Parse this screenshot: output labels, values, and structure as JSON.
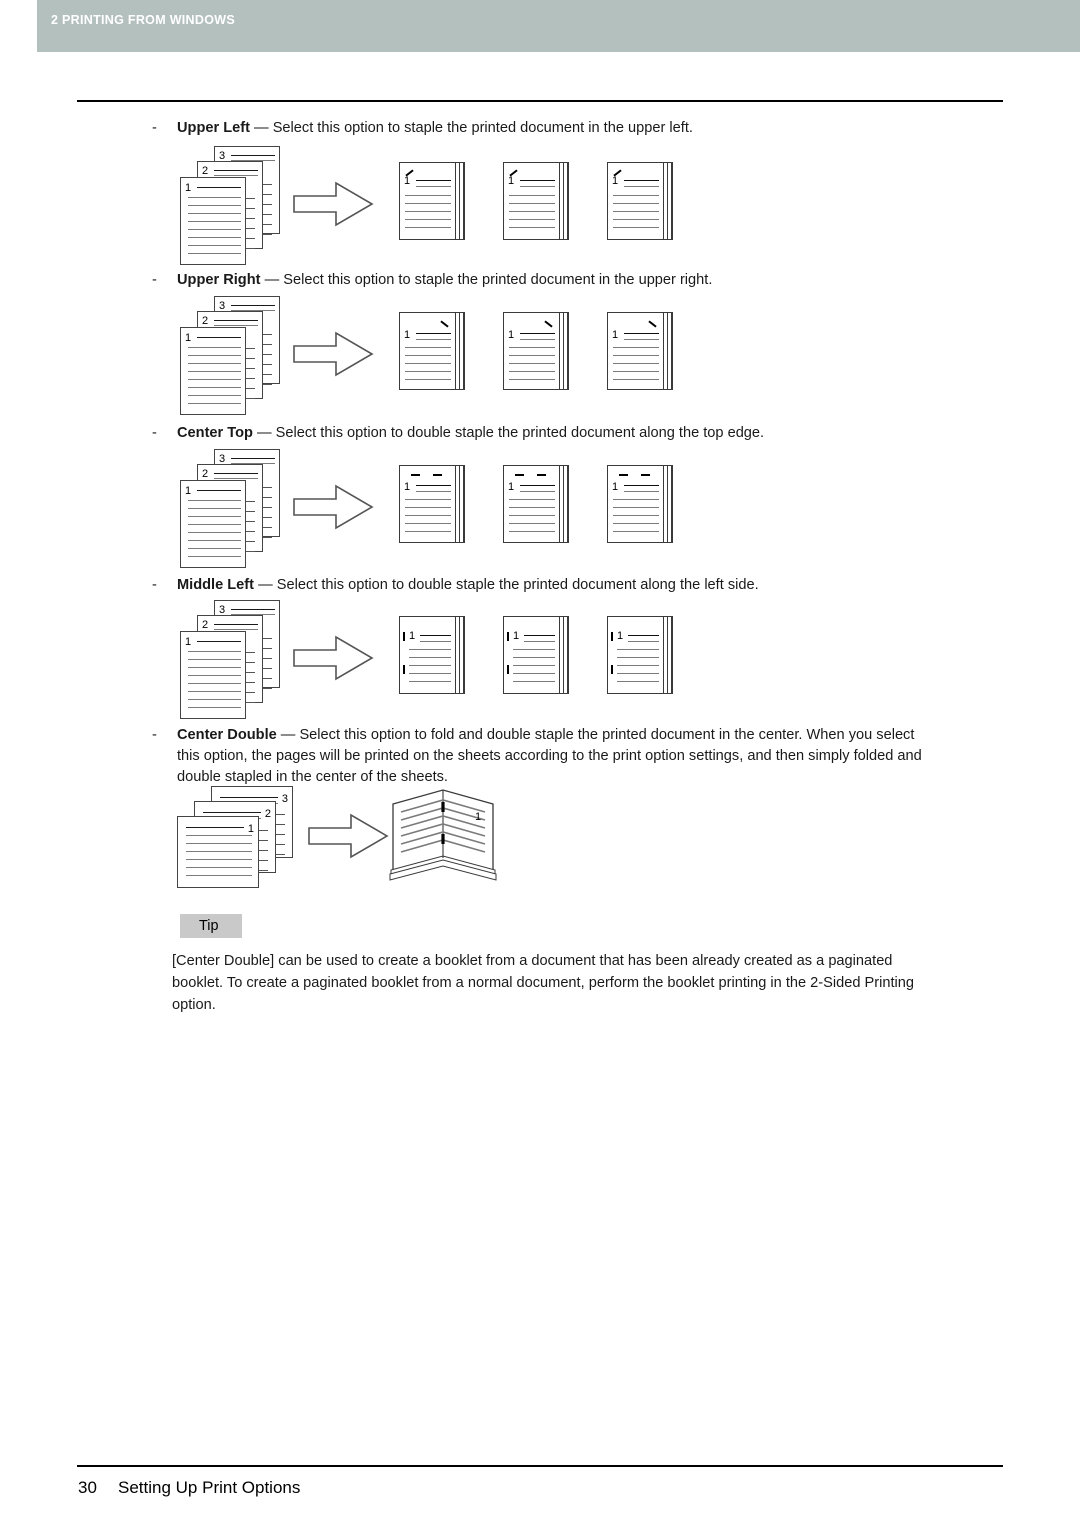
{
  "header": {
    "chapter_number": "2",
    "chapter_title": "PRINTING FROM WINDOWS",
    "full_text": "2 PRINTING FROM WINDOWS",
    "band_color": "#b4c0be",
    "text_color": "#ffffff"
  },
  "footer": {
    "page_number": "30",
    "section_title": "Setting Up Print Options"
  },
  "options": [
    {
      "bullet": "-",
      "term": "Upper Left",
      "dash": "—",
      "description": "Select this option to staple the printed document in the upper left.",
      "staple_position": "upper-left",
      "staple_count": 1
    },
    {
      "bullet": "-",
      "term": "Upper Right",
      "dash": "—",
      "description": "Select this option to staple the printed document in the upper right.",
      "staple_position": "upper-right",
      "staple_count": 1
    },
    {
      "bullet": "-",
      "term": "Center Top",
      "dash": "—",
      "description": "Select this option to double staple the printed document along the top edge.",
      "staple_position": "center-top",
      "staple_count": 2
    },
    {
      "bullet": "-",
      "term": "Middle Left",
      "dash": "—",
      "description": "Select this option to double staple the printed document along the left side.",
      "staple_position": "middle-left",
      "staple_count": 2
    }
  ],
  "center_double": {
    "bullet": "-",
    "term": "Center Double",
    "dash": "—",
    "description_line1": "Select this option to fold and double staple the printed document in the center. When you select",
    "description_line2": "this option, the pages will be printed on the sheets according to the print option settings, and then simply folded and",
    "description_line3": "double stapled in the center of the sheets."
  },
  "diagram": {
    "source_stack_labels": [
      "3",
      "2",
      "1"
    ],
    "output_page_label": "1",
    "booklet_page_label": "1",
    "arrow_icon": "right-arrow-icon"
  },
  "tip": {
    "label": "Tip",
    "box_color": "#c9c9c9",
    "line1": "[Center Double] can be used to create a booklet from a document that has been already created as a paginated",
    "line2": "booklet. To create a paginated booklet from a normal document, perform the booklet printing in the 2-Sided Printing",
    "line3": "option."
  }
}
